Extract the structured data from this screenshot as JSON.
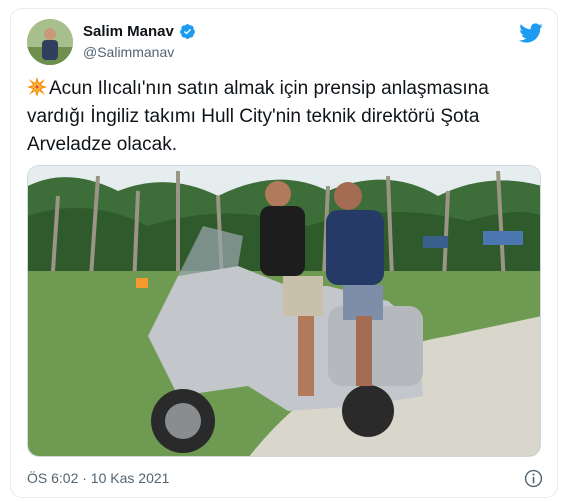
{
  "tweet": {
    "author_name": "Salim Manav",
    "author_handle": "@Salimmanav",
    "verified": true,
    "text": "Acun Ilıcalı'nın satın almak için prensip anlaşmasına vardığı İngiliz takımı Hull City'nin teknik direktörü Şota Arveladze olacak.",
    "text_emoji": "collision-emoji",
    "timestamp": "ÖS 6:02 · 10 Kas 2021"
  },
  "icons": {
    "verified": "verified-badge-icon",
    "brand": "twitter-bird-icon",
    "info": "info-icon"
  },
  "colors": {
    "brand_blue": "#1d9bf0",
    "text_primary": "#0f1419",
    "text_secondary": "#536471",
    "border": "#e6ecf0"
  }
}
